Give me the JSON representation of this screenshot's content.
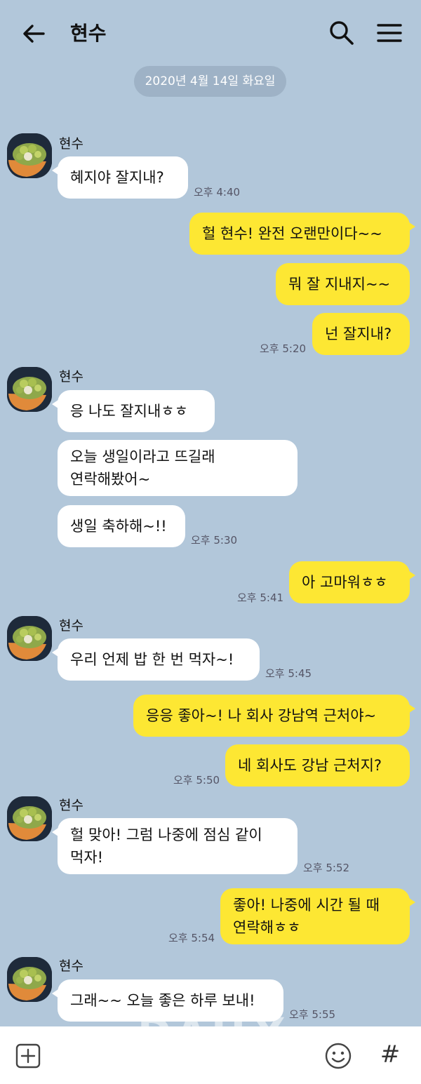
{
  "header": {
    "title": "현수"
  },
  "date_divider": "2020년 4월 14일 화요일",
  "sender_name": "현수",
  "messages": {
    "m1": "혜지야 잘지내?",
    "t1": "오후 4:40",
    "m2": "헐 현수! 완전 오랜만이다~~",
    "m3": "뭐 잘 지내지~~",
    "m4": "넌 잘지내?",
    "t4": "오후 5:20",
    "m5": "응 나도 잘지내ㅎㅎ",
    "m6_line1": "오늘 생일이라고 뜨길래",
    "m6_line2": "연락해봤어~",
    "m7": "생일 축하해~!!",
    "t7": "오후 5:30",
    "m8": "아 고마워ㅎㅎ",
    "t8": "오후 5:41",
    "m9": "우리 언제 밥 한 번 먹자~!",
    "t9": "오후 5:45",
    "m10": "응응 좋아~! 나 회사 강남역 근처야~",
    "m11": "네 회사도 강남 근처지?",
    "t11": "오후 5:50",
    "m12_line1": "헐 맞아! 그럼 나중에 점심 같이",
    "m12_line2": "먹자!",
    "t12": "오후 5:52",
    "m13_line1": "좋아! 나중에 시간 될 때",
    "m13_line2": "연락해ㅎㅎ",
    "t13": "오후 5:54",
    "m14": "그래~~ 오늘 좋은 하루 보내!",
    "t14": "오후 5:55"
  },
  "watermark": "DAILY",
  "input_bar": {
    "hash_label": "#"
  },
  "icons": {
    "back": "arrow-left-icon",
    "search": "search-icon",
    "menu": "hamburger-menu-icon",
    "add": "plus-square-icon",
    "emoji": "smiley-icon",
    "hash": "hash-icon"
  },
  "colors": {
    "background": "#b2c7da",
    "outgoing_bubble": "#fde733",
    "incoming_bubble": "#ffffff"
  }
}
